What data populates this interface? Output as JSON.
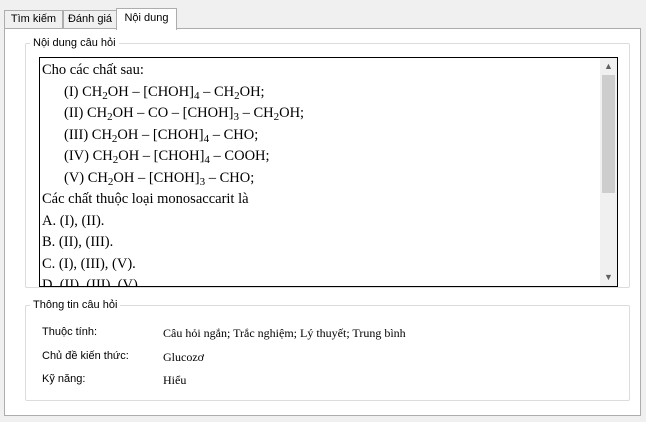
{
  "tabs": [
    {
      "label": "Tìm kiếm"
    },
    {
      "label": "Đánh giá"
    },
    {
      "label": "Nội dung"
    }
  ],
  "content_group": {
    "title": "Nội dung câu hỏi",
    "question": {
      "intro": "Cho các chất sau:",
      "items": [
        {
          "pre": "(I) CH",
          "s1": "2",
          "mid": "OH – [CHOH]",
          "s2": "4",
          "post": " – CH",
          "s3": "2",
          "end": "OH;"
        },
        {
          "pre": "(II) CH",
          "s1": "2",
          "mid": "OH – CO – [CHOH]",
          "s2": "3",
          "post": " – CH",
          "s3": "2",
          "end": "OH;"
        },
        {
          "pre": "(III) CH",
          "s1": "2",
          "mid": "OH – [CHOH]",
          "s2": "4",
          "post": " – CHO;"
        },
        {
          "pre": "(IV) CH",
          "s1": "2",
          "mid": "OH – [CHOH]",
          "s2": "4",
          "post": " – COOH;"
        },
        {
          "pre": "(V) CH",
          "s1": "2",
          "mid": "OH – [CHOH]",
          "s2": "3",
          "post": " – CHO;"
        }
      ],
      "prompt": "Các chất thuộc loại monosaccarit là",
      "options": [
        "A.  (I), (II).",
        "B.  (II), (III).",
        "C.  (I), (III), (V).",
        "D.  (II), (III), (V)."
      ]
    },
    "scroll_up_glyph": "▲",
    "scroll_down_glyph": "▼"
  },
  "info_group": {
    "title": "Thông tin câu hỏi",
    "rows": [
      {
        "label": "Thuộc tính:",
        "value": "Câu hỏi ngắn; Trắc nghiệm; Lý thuyết; Trung bình"
      },
      {
        "label": "Chủ đề kiến thức:",
        "value": "Glucozơ"
      },
      {
        "label": "Kỹ năng:",
        "value": "Hiểu"
      }
    ]
  },
  "colors": {
    "window_bg": "#f0f0f0",
    "border": "#adadad",
    "scroll_thumb": "#cdcdcd"
  }
}
